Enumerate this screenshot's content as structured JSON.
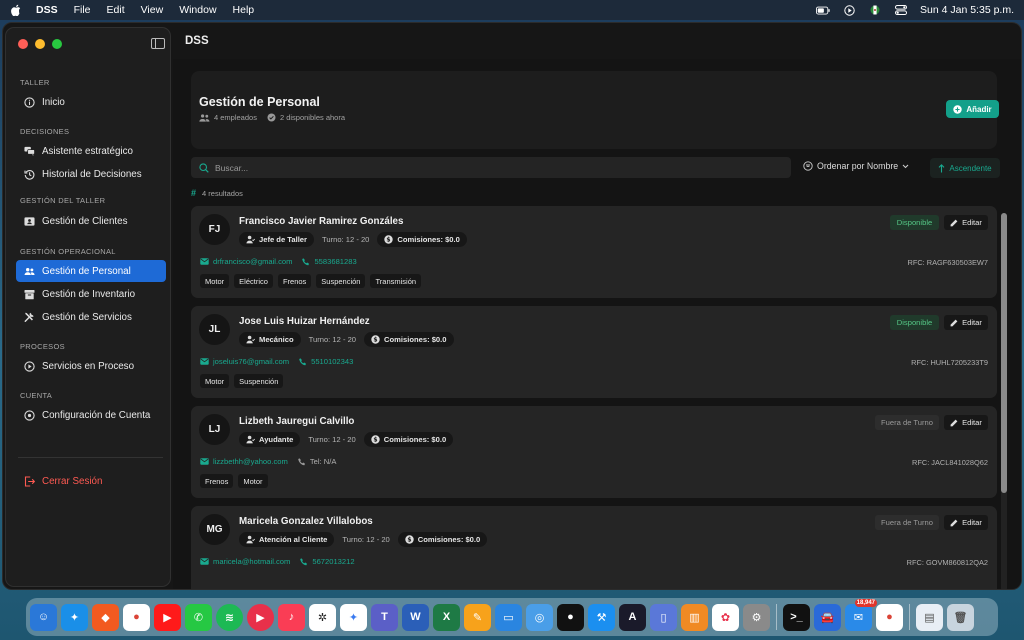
{
  "menubar": {
    "app_name": "DSS",
    "menus": [
      "File",
      "Edit",
      "View",
      "Window",
      "Help"
    ],
    "clock": "Sun 4 Jan  5:35 p.m."
  },
  "window": {
    "title": "DSS"
  },
  "sidebar": {
    "sections": {
      "taller": "TALLER",
      "decisiones": "DECISIONES",
      "gestion_taller": "GESTIÓN DEL TALLER",
      "gestion_operacional": "GESTIÓN OPERACIONAL",
      "procesos": "PROCESOS",
      "cuenta": "CUENTA"
    },
    "items": {
      "inicio": "Inicio",
      "asistente": "Asistente estratégico",
      "historial": "Historial de Decisiones",
      "clientes": "Gestión de Clientes",
      "personal": "Gestión de Personal",
      "inventario": "Gestión de Inventario",
      "servicios": "Gestión de Servicios",
      "en_proceso": "Servicios en Proceso",
      "configuracion": "Configuración de Cuenta"
    },
    "logout": "Cerrar Sesión"
  },
  "header": {
    "title": "Gestión de Personal",
    "employees": "4 empleados",
    "available": "2 disponibles ahora",
    "add_label": "Añadir"
  },
  "toolbar": {
    "search_placeholder": "Buscar...",
    "sort_label": "Ordenar por Nombre",
    "order_label": "Ascendente",
    "results": "4 resultados"
  },
  "labels": {
    "turno_prefix": "Turno: ",
    "comisiones_prefix": "Comisiones: ",
    "rfc_prefix": "RFC: ",
    "edit": "Editar"
  },
  "employees": [
    {
      "initials": "FJ",
      "name": "Francisco Javier Ramirez Gonzáles",
      "role": "Jefe de Taller",
      "turno": "Turno: 12 - 20",
      "comisiones": "Comisiones: $0.0",
      "email": "drfrancisco@gmail.com",
      "phone": "5583681283",
      "rfc": "RFC: RAGF630503EW7",
      "status": "Disponible",
      "tags": [
        "Motor",
        "Eléctrico",
        "Frenos",
        "Suspención",
        "Transmisión"
      ]
    },
    {
      "initials": "JL",
      "name": "Jose Luis Huizar Hernández",
      "role": "Mecánico",
      "turno": "Turno: 12 - 20",
      "comisiones": "Comisiones: $0.0",
      "email": "joseluis76@gmail.com",
      "phone": "5510102343",
      "rfc": "RFC: HUHL7205233T9",
      "status": "Disponible",
      "tags": [
        "Motor",
        "Suspención"
      ]
    },
    {
      "initials": "LJ",
      "name": "Lizbeth Jauregui Calvillo",
      "role": "Ayudante",
      "turno": "Turno: 12 - 20",
      "comisiones": "Comisiones: $0.0",
      "email": "lizzbethh@yahoo.com",
      "phone": "Tel: N/A",
      "rfc": "RFC: JACL841028Q62",
      "status": "Fuera de Turno",
      "tags": [
        "Frenos",
        "Motor"
      ]
    },
    {
      "initials": "MG",
      "name": "Maricela Gonzalez Villalobos",
      "role": "Atención al Cliente",
      "turno": "Turno: 12 - 20",
      "comisiones": "Comisiones: $0.0",
      "email": "maricela@hotmail.com",
      "phone": "5672013212",
      "rfc": "RFC: GOVM860812QA2",
      "status": "Fuera de Turno",
      "tags": []
    }
  ],
  "dock": {
    "mail_badge": "18,947"
  }
}
